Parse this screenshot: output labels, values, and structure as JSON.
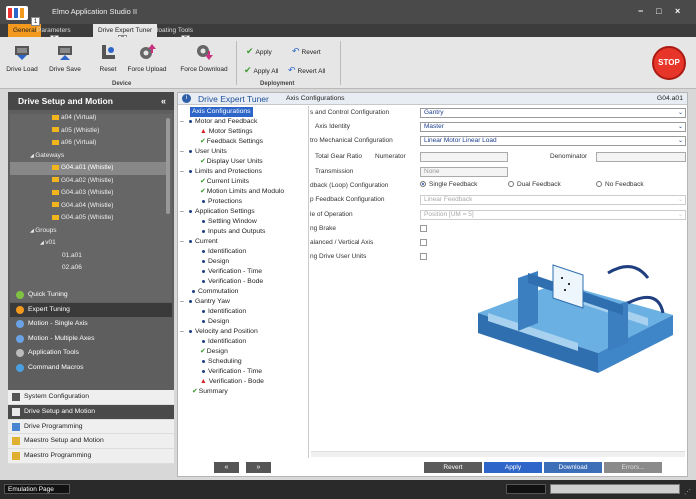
{
  "window": {
    "title": "Elmo Application Studio II",
    "minimize": "−",
    "maximize": "□",
    "close": "×"
  },
  "ribbon_tabs": [
    {
      "label": "General",
      "keytip": "1"
    },
    {
      "label": "Parameters",
      "keytip": "P"
    },
    {
      "label": "Drive Expert Tuner",
      "keytip": "T"
    },
    {
      "label": "Floating Tools",
      "keytip": "F"
    }
  ],
  "ribbon": {
    "device_group": {
      "label": "Device",
      "buttons": [
        "Drive Load",
        "Drive Save",
        "Reset",
        "Force Upload",
        "Force Download"
      ]
    },
    "deployment_group": {
      "label": "Deployment",
      "apply": "Apply",
      "revert": "Revert",
      "apply_all": "Apply All",
      "revert_all": "Revert All"
    },
    "stop": "STOP",
    "help": "?",
    "collapse": "⌃"
  },
  "left_panel": {
    "title": "Drive Setup and Motion",
    "collapse": "«",
    "tree": [
      {
        "label": "a04 (Virtual)",
        "icon": true,
        "indent": 42,
        "selected": false
      },
      {
        "label": "a05 (Whistle)",
        "icon": true,
        "indent": 42,
        "selected": false
      },
      {
        "label": "a06 (Virtual)",
        "icon": true,
        "indent": 42,
        "selected": false
      },
      {
        "label": "Gateways",
        "icon": false,
        "indent": 20,
        "selected": false,
        "prefix": "◢"
      },
      {
        "label": "G04.a01 (Whistle)",
        "icon": true,
        "indent": 42,
        "selected": true
      },
      {
        "label": "G04.a02 (Whistle)",
        "icon": true,
        "indent": 42,
        "selected": false
      },
      {
        "label": "G04.a03 (Whistle)",
        "icon": true,
        "indent": 42,
        "selected": false
      },
      {
        "label": "G04.a04 (Whistle)",
        "icon": true,
        "indent": 42,
        "selected": false
      },
      {
        "label": "G04.a05 (Whistle)",
        "icon": true,
        "indent": 42,
        "selected": false
      },
      {
        "label": "Groups",
        "icon": false,
        "indent": 20,
        "selected": false,
        "prefix": "◢"
      },
      {
        "label": "v01",
        "icon": false,
        "indent": 30,
        "selected": false,
        "prefix": "◢"
      },
      {
        "label": "01.a01",
        "icon": false,
        "indent": 52,
        "selected": false
      },
      {
        "label": "02.a06",
        "icon": false,
        "indent": 52,
        "selected": false
      }
    ],
    "sections": [
      {
        "label": "Quick Tuning",
        "active": false,
        "color": "#7fc241"
      },
      {
        "label": "Expert Tuning",
        "active": true,
        "color": "#f39a1e"
      },
      {
        "label": "Motion - Single Axis",
        "active": false,
        "color": "#6aa2e6"
      },
      {
        "label": "Motion - Multiple Axes",
        "active": false,
        "color": "#6aa2e6"
      },
      {
        "label": "Application Tools",
        "active": false,
        "color": "#bbbbbb"
      },
      {
        "label": "Command Macros",
        "active": false,
        "color": "#4aa0e0"
      }
    ],
    "main_nav": [
      {
        "label": "System Configuration",
        "active": false,
        "color": "#555555"
      },
      {
        "label": "Drive Setup and Motion",
        "active": true,
        "color": "#e8e8e8"
      },
      {
        "label": "Drive Programming",
        "active": false,
        "color": "#4a86d0"
      },
      {
        "label": "Maestro Setup and Motion",
        "active": false,
        "color": "#e0b030"
      },
      {
        "label": "Maestro Programming",
        "active": false,
        "color": "#e0b030"
      }
    ]
  },
  "content": {
    "icon": "i",
    "title": "Drive Expert Tuner",
    "page": "Axis Configurations",
    "axis_id": "G04.a01",
    "config_tree": [
      {
        "label": "Axis Configurations",
        "kind": "sel",
        "indent": 10
      },
      {
        "label": "Motor and Feedback",
        "kind": "dotgrp",
        "indent": 0
      },
      {
        "label": "Motor Settings",
        "kind": "warn",
        "indent": 20
      },
      {
        "label": "Feedback Settings",
        "kind": "ok",
        "indent": 20
      },
      {
        "label": "User Units",
        "kind": "dotgrp",
        "indent": 0
      },
      {
        "label": "Display User Units",
        "kind": "ok",
        "indent": 20
      },
      {
        "label": "Limits and Protections",
        "kind": "dotgrp",
        "indent": 0
      },
      {
        "label": "Current Limits",
        "kind": "ok",
        "indent": 20
      },
      {
        "label": "Motion Limits and Modulo",
        "kind": "ok",
        "indent": 20
      },
      {
        "label": "Protections",
        "kind": "dot",
        "indent": 22
      },
      {
        "label": "Application Settings",
        "kind": "dotgrp",
        "indent": 0
      },
      {
        "label": "Settling Window",
        "kind": "dot",
        "indent": 22
      },
      {
        "label": "Inputs and Outputs",
        "kind": "dot",
        "indent": 22
      },
      {
        "label": "Current",
        "kind": "dotgrp",
        "indent": 0
      },
      {
        "label": "Identification",
        "kind": "dot",
        "indent": 22
      },
      {
        "label": "Design",
        "kind": "dot",
        "indent": 22
      },
      {
        "label": "Verification - Time",
        "kind": "dot",
        "indent": 22
      },
      {
        "label": "Verification - Bode",
        "kind": "dot",
        "indent": 22
      },
      {
        "label": "Commutation",
        "kind": "dot",
        "indent": 12
      },
      {
        "label": "Gantry Yaw",
        "kind": "dotgrp",
        "indent": 0
      },
      {
        "label": "Identification",
        "kind": "dot",
        "indent": 22
      },
      {
        "label": "Design",
        "kind": "dot",
        "indent": 22
      },
      {
        "label": "Velocity and Position",
        "kind": "dotgrp",
        "indent": 0
      },
      {
        "label": "Identification",
        "kind": "dot",
        "indent": 22
      },
      {
        "label": "Design",
        "kind": "ok",
        "indent": 20
      },
      {
        "label": "Scheduling",
        "kind": "dot",
        "indent": 22
      },
      {
        "label": "Verification - Time",
        "kind": "dot",
        "indent": 22
      },
      {
        "label": "Verification - Bode",
        "kind": "warn",
        "indent": 20
      },
      {
        "label": "Summary",
        "kind": "ok",
        "indent": 12
      }
    ],
    "form": {
      "control_config_label": "s and Control Configuration",
      "control_config_value": "Gantry",
      "axis_identity_label": "Axis Identity",
      "axis_identity_value": "Master",
      "mech_config_label": "tro Mechanical Configuration",
      "mech_config_value": "Linear Motor Linear Load",
      "gear_ratio_label": "Total Gear Ratio",
      "numerator_label": "Numerator",
      "denominator_label": "Denominator",
      "transmission_label": "Transmission",
      "transmission_value": "None",
      "feedback_loop_label": "dback (Loop) Configuration",
      "radio_single": "Single Feedback",
      "radio_dual": "Dual Feedback",
      "radio_none": "No Feedback",
      "feedback_config_label": "p Feedback Configuration",
      "feedback_config_value": "Linear Feedback",
      "mode_label": "le of Operation",
      "mode_value": "Position [UM = 5]",
      "brake_label": "ng Brake",
      "balanced_label": "alanced / Vertical Axis",
      "drive_user_units_label": "ng Drive User Units"
    },
    "buttons": {
      "prev": "«",
      "next": "»",
      "revert": "Revert",
      "apply": "Apply",
      "download": "Download",
      "errors": "Errors..."
    }
  },
  "status": {
    "mode": "Emulation Page"
  }
}
